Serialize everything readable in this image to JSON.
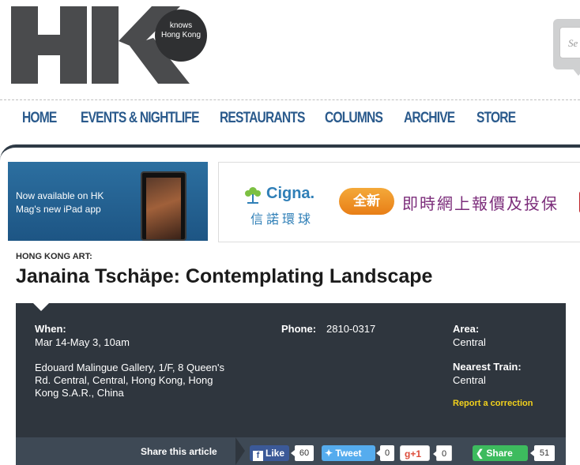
{
  "logo": {
    "bubble_line1": "knows",
    "bubble_line2": "Hong Kong"
  },
  "search": {
    "placeholder_fragment": "Se"
  },
  "nav": {
    "items": [
      "HOME",
      "EVENTS & NIGHTLIFE",
      "RESTAURANTS",
      "COLUMNS",
      "ARCHIVE",
      "STORE"
    ],
    "color": "#2a5a8c"
  },
  "ads": {
    "ipad": {
      "line1": "Now available on HK",
      "line2": "Mag's new iPad app"
    },
    "cigna": {
      "name": "Cigna.",
      "chinese_name": "信諾環球",
      "badge": "全新",
      "slogan": "即時網上報價及投保"
    }
  },
  "article": {
    "kicker": "HONG KONG ART:",
    "title": "Janaina Tschäpe: Contemplating Landscape"
  },
  "info": {
    "when_label": "When:",
    "when_value": "Mar 14-May 3, 10am",
    "address_line1": "Edouard Malingue Gallery, 1/F, 8 Queen's",
    "address_line2": "Rd. Central, Central, Hong Kong, Hong",
    "address_line3": "Kong S.A.R., China",
    "phone_label": "Phone:",
    "phone_value": "2810-0317",
    "area_label": "Area:",
    "area_value": "Central",
    "train_label": "Nearest Train:",
    "train_value": "Central",
    "report_link": "Report a correction"
  },
  "share": {
    "label": "Share this article",
    "facebook": {
      "label": "Like",
      "icon_letter": "f",
      "count": "60"
    },
    "twitter": {
      "label": "Tweet",
      "count": "0"
    },
    "gplus": {
      "label": "g+1",
      "count": "0"
    },
    "share": {
      "label": "Share",
      "count": "51"
    }
  }
}
